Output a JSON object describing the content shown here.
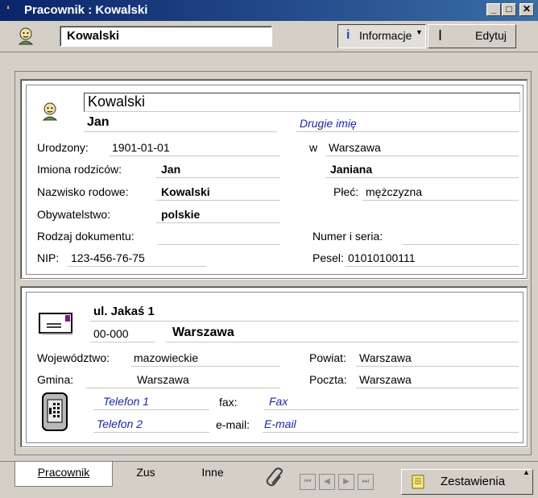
{
  "window": {
    "title": "Pracownik : Kowalski",
    "minimize": "_",
    "maximize": "□",
    "close": "✕"
  },
  "toolbar": {
    "name": "Kowalski",
    "info_label": "Informacje",
    "edit_label": "Edytuj"
  },
  "person": {
    "surname": "Kowalski",
    "first_name": "Jan",
    "second_name_placeholder": "Drugie imię",
    "born_label": "Urodzony:",
    "born_value": "1901-01-01",
    "born_in_label": "w",
    "born_in_value": "Warszawa",
    "parents_label": "Imiona rodziców:",
    "father": "Jan",
    "mother": "Janiana",
    "maiden_label": "Nazwisko rodowe:",
    "maiden_value": "Kowalski",
    "sex_label": "Płeć:",
    "sex_value": "mężczyzna",
    "citizenship_label": "Obywatelstwo:",
    "citizenship_value": "polskie",
    "doc_label": "Rodzaj dokumentu:",
    "doc_number_label": "Numer i seria:",
    "nip_label": "NIP:",
    "nip_value": "123-456-76-75",
    "pesel_label": "Pesel:",
    "pesel_value": "01010100111"
  },
  "address": {
    "street": "ul. Jakaś 1",
    "postcode": "00-000",
    "city": "Warszawa",
    "voivodeship_label": "Województwo:",
    "voivodeship_value": "mazowieckie",
    "county_label": "Powiat:",
    "county_value": "Warszawa",
    "commune_label": "Gmina:",
    "commune_value": "Warszawa",
    "post_label": "Poczta:",
    "post_value": "Warszawa",
    "phone1": "Telefon 1",
    "phone2": "Telefon 2",
    "fax_label": "fax:",
    "fax_value": "Fax",
    "email_label": "e-mail:",
    "email_value": "E-mail"
  },
  "tabs": [
    {
      "label": "Pracownik"
    },
    {
      "label": "Zus"
    },
    {
      "label": "Inne"
    }
  ],
  "reports_label": "Zestawienia",
  "icons": [
    "person-icon",
    "info-icon",
    "text-cursor-icon",
    "envelope-icon",
    "phone-icon",
    "paperclip-icon",
    "report-icon"
  ]
}
